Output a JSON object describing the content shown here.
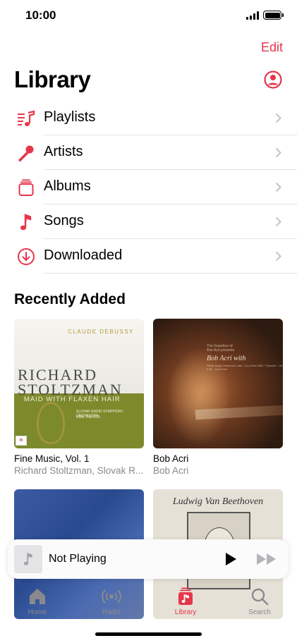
{
  "status_bar": {
    "time": "10:00"
  },
  "header": {
    "edit_label": "Edit",
    "title": "Library"
  },
  "menu": {
    "items": [
      {
        "label": "Playlists",
        "icon": "playlist-icon"
      },
      {
        "label": "Artists",
        "icon": "microphone-icon"
      },
      {
        "label": "Albums",
        "icon": "album-stack-icon"
      },
      {
        "label": "Songs",
        "icon": "music-note-icon"
      },
      {
        "label": "Downloaded",
        "icon": "download-circle-icon"
      }
    ]
  },
  "recently_added": {
    "title": "Recently Added",
    "albums": [
      {
        "title": "Fine Music, Vol. 1",
        "artist": "Richard Stoltzman, Slovak R...",
        "art_text": {
          "composer": "CLAUDE DEBUSSY",
          "name_line1": "RICHARD",
          "name_line2": "STOLTZMAN",
          "subtitle": "MAID WITH FLAXEN HAIR",
          "orchestra": "SLOVAK RADIO SYMPHONY ORCHESTRA",
          "conductor": "KIRK TREVOR",
          "label": "n"
        }
      },
      {
        "title": "Bob Acri",
        "artist": "Bob Acri",
        "art_text": {
          "line1": "The Grandeur of",
          "line2": "Bob Acri presents",
          "name": "Bob Acri with",
          "tracks": "Sleep Away Cinnamon Lake · Cry of the Wild · Pyramid · Let It Be · Scot Free"
        }
      },
      {
        "title": "",
        "artist": ""
      },
      {
        "title": "",
        "artist": "",
        "art_text": {
          "composer": "Ludwig Van Beethoven"
        }
      }
    ]
  },
  "mini_player": {
    "title": "Not Playing"
  },
  "tabs": [
    {
      "label": "Home",
      "icon": "home-icon",
      "active": false
    },
    {
      "label": "Radio",
      "icon": "radio-icon",
      "active": false
    },
    {
      "label": "Library",
      "icon": "library-icon",
      "active": true
    },
    {
      "label": "Search",
      "icon": "search-icon",
      "active": false
    }
  ],
  "colors": {
    "accent": "#e5364a",
    "secondary_text": "#8a8a8e",
    "tab_bar": "#e9e9ea"
  }
}
